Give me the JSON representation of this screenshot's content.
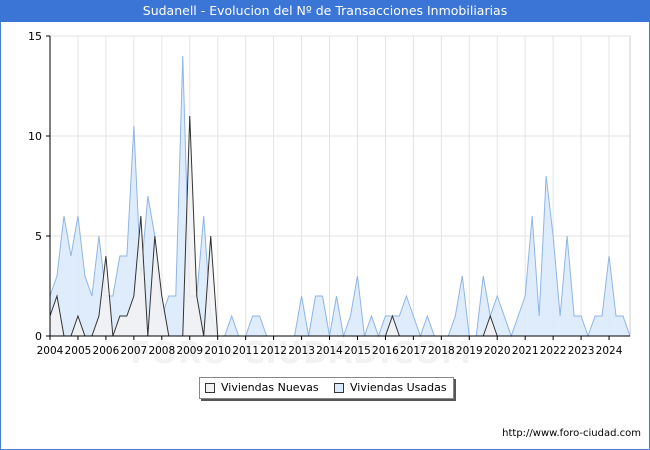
{
  "title": "Sudanell - Evolucion del Nº de Transacciones Inmobiliarias",
  "footer_url": "http://www.foro-ciudad.com",
  "watermark": "FORO-CIUDAD.COM",
  "legend": {
    "nuevas": "Viviendas Nuevas",
    "usadas": "Viviendas Usadas"
  },
  "colors": {
    "nuevas_fill": "#f2f2f2",
    "nuevas_line": "#333333",
    "usadas_fill": "#dbeafb",
    "usadas_line": "#8fb5e6",
    "title_bg": "#3b75d6"
  },
  "chart_data": {
    "type": "area",
    "x_start": 2004,
    "x_end": 2024.75,
    "ylim": [
      0,
      15
    ],
    "y_ticks": [
      0,
      5,
      10,
      15
    ],
    "x_ticks": [
      2004,
      2005,
      2006,
      2007,
      2008,
      2009,
      2010,
      2011,
      2012,
      2013,
      2014,
      2015,
      2016,
      2017,
      2018,
      2019,
      2020,
      2021,
      2022,
      2023,
      2024
    ],
    "grid": true,
    "legend_position": "bottom",
    "x": [
      2004.0,
      2004.25,
      2004.5,
      2004.75,
      2005.0,
      2005.25,
      2005.5,
      2005.75,
      2006.0,
      2006.25,
      2006.5,
      2006.75,
      2007.0,
      2007.25,
      2007.5,
      2007.75,
      2008.0,
      2008.25,
      2008.5,
      2008.75,
      2009.0,
      2009.25,
      2009.5,
      2009.75,
      2010.0,
      2010.25,
      2010.5,
      2010.75,
      2011.0,
      2011.25,
      2011.5,
      2011.75,
      2012.0,
      2012.25,
      2012.5,
      2012.75,
      2013.0,
      2013.25,
      2013.5,
      2013.75,
      2014.0,
      2014.25,
      2014.5,
      2014.75,
      2015.0,
      2015.25,
      2015.5,
      2015.75,
      2016.0,
      2016.25,
      2016.5,
      2016.75,
      2017.0,
      2017.25,
      2017.5,
      2017.75,
      2018.0,
      2018.25,
      2018.5,
      2018.75,
      2019.0,
      2019.25,
      2019.5,
      2019.75,
      2020.0,
      2020.25,
      2020.5,
      2020.75,
      2021.0,
      2021.25,
      2021.5,
      2021.75,
      2022.0,
      2022.25,
      2022.5,
      2022.75,
      2023.0,
      2023.25,
      2023.5,
      2023.75,
      2024.0,
      2024.25,
      2024.5,
      2024.75
    ],
    "series": [
      {
        "name": "Viviendas Nuevas",
        "values": [
          1,
          2,
          0,
          0,
          1,
          0,
          0,
          1,
          4,
          0,
          1,
          1,
          2,
          6,
          0,
          5,
          2,
          0,
          0,
          0,
          11,
          2,
          0,
          5,
          0,
          0,
          0,
          0,
          0,
          0,
          0,
          0,
          0,
          0,
          0,
          0,
          0,
          0,
          0,
          0,
          0,
          0,
          0,
          0,
          0,
          0,
          0,
          0,
          0,
          1,
          0,
          0,
          0,
          0,
          0,
          0,
          0,
          0,
          0,
          0,
          0,
          0,
          0,
          1,
          0,
          0,
          0,
          0,
          0,
          0,
          0,
          0,
          0,
          0,
          0,
          0,
          0,
          0,
          0,
          0,
          0,
          0,
          0,
          0
        ]
      },
      {
        "name": "Viviendas Usadas",
        "values": [
          2,
          3,
          6,
          4,
          6,
          3,
          2,
          5,
          2,
          2,
          4,
          4,
          10.5,
          3,
          7,
          5,
          1,
          2,
          2,
          14,
          2,
          2,
          6,
          1,
          0,
          0,
          1,
          0,
          0,
          1,
          1,
          0,
          0,
          0,
          0,
          0,
          2,
          0,
          2,
          2,
          0,
          2,
          0,
          1,
          3,
          0,
          1,
          0,
          1,
          1,
          1,
          2,
          1,
          0,
          1,
          0,
          0,
          0,
          1,
          3,
          0,
          0,
          3,
          1,
          2,
          1,
          0,
          1,
          2,
          6,
          1,
          8,
          5,
          1,
          5,
          1,
          1,
          0,
          1,
          1,
          4,
          1,
          1,
          0
        ]
      }
    ]
  }
}
